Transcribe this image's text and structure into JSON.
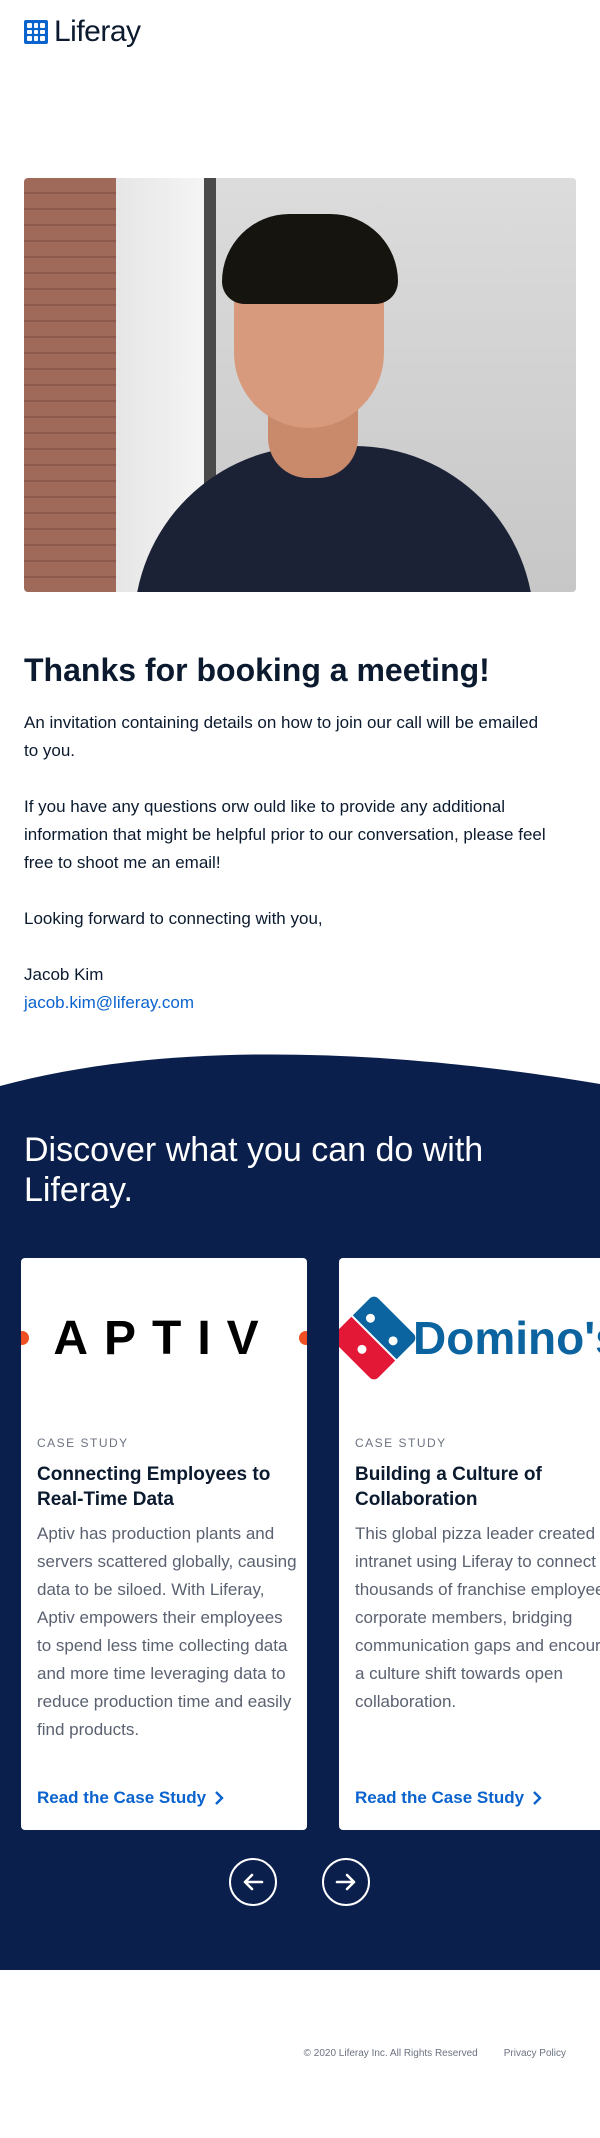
{
  "brand": {
    "name": "Liferay",
    "color": "#0b63ce"
  },
  "hero": {
    "image": "portrait-photo"
  },
  "main": {
    "title": "Thanks for booking a meeting!",
    "paragraph1": "An invitation containing details on how to join our call will be emailed to you.",
    "paragraph2": "If you have any questions orw ould like to provide any additional information that might be helpful prior to our conversation, please feel free to shoot me an email!",
    "closing": "Looking forward to connecting with you,",
    "signature_name": "Jacob Kim",
    "signature_email": "jacob.kim@liferay.com"
  },
  "discover": {
    "title": "Discover what you can do with Liferay.",
    "background": "#0b1f4d",
    "cards": [
      {
        "logo_text": "APTIV",
        "eyebrow": "CASE STUDY",
        "title": "Connecting Employees to Real-Time Data",
        "body": "Aptiv has production plants and servers scattered globally, causing data to be siloed. With Liferay, Aptiv empowers their employees to spend less time collecting data and more time leveraging data to reduce production time and easily find products.",
        "link": "Read the Case Study"
      },
      {
        "logo_text": "Domino's",
        "eyebrow": "CASE STUDY",
        "title": "Building a Culture of Collaboration",
        "body": "This global pizza leader created an intranet using Liferay to connect their thousands of franchise employees to corporate members, bridging communication gaps and encouraging a culture shift towards open collaboration.",
        "link": "Read the Case Study"
      }
    ],
    "nav": {
      "prev_icon": "arrow-left-icon",
      "next_icon": "arrow-right-icon"
    }
  },
  "footer": {
    "copyright": "© 2020 Liferay Inc. All Rights Reserved",
    "privacy": "Privacy Policy"
  }
}
